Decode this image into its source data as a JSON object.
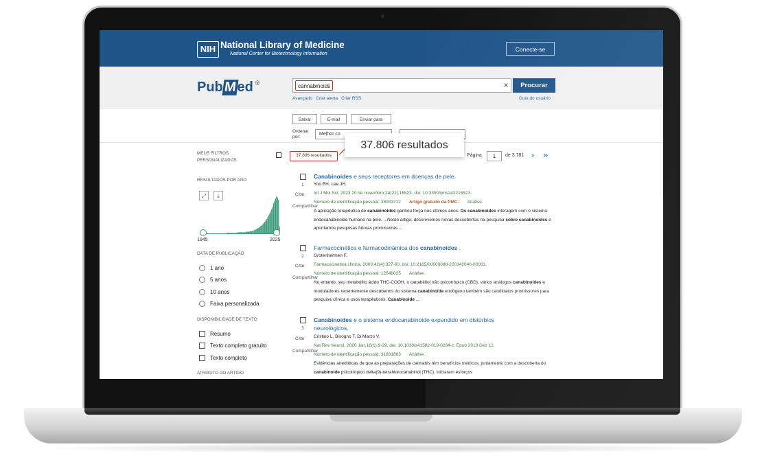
{
  "header": {
    "nih_badge": "NIH",
    "org_name": "National Library of Medicine",
    "org_sub": "National Center for Biotechnology Information",
    "login_label": "Conecte-se"
  },
  "search": {
    "logo_pub": "Pub",
    "logo_m": "M",
    "logo_ed": "ed",
    "logo_reg": "®",
    "query": "cannabinoids",
    "clear_icon": "×",
    "submit_label": "Procurar",
    "links": [
      "Avançado",
      "Criar alerta",
      "Criar RSS"
    ],
    "guide_link": "Guia do usuário"
  },
  "actions": {
    "save": "Salvar",
    "email": "E-mail",
    "send_to": "Enviar para",
    "sort_label": "Ordenar por:",
    "sort_value": "Melhor co"
  },
  "callout": {
    "text": "37.806 resultados"
  },
  "sidebar": {
    "my_filters": "MEUS FILTROS PERSONALIZADOS",
    "results_by_year": "RESULTADOS POR ANO",
    "expand_icon": "expand-icon",
    "download_icon": "download-icon",
    "year_start": "1945",
    "year_end": "2025",
    "pub_date_heading": "DATA DE PUBLICAÇÃO",
    "pub_date_options": [
      "1 ano",
      "5 anos",
      "10 anos",
      "Faixa personalizada"
    ],
    "text_avail_heading": "DISPONIBILIDADE DE TEXTO",
    "text_avail_options": [
      "Resumo",
      "Texto completo gratuito",
      "Texto completo"
    ],
    "article_attr_heading": "ATRIBUTO DO ARTIGO"
  },
  "chart_data": {
    "type": "area",
    "title": "",
    "xlabel": "",
    "ylabel": "",
    "x_range": [
      1945,
      2025
    ],
    "values": [
      0,
      0,
      0,
      0,
      0,
      0,
      0,
      0,
      0,
      0,
      0,
      0,
      0,
      0,
      0,
      0,
      0,
      0,
      0,
      0,
      0,
      0,
      0,
      0,
      0,
      0,
      0,
      1,
      1,
      1,
      1,
      1,
      1,
      1,
      1,
      1,
      1,
      1,
      2,
      2,
      2,
      2,
      2,
      2,
      2,
      2,
      3,
      3,
      3,
      3,
      4,
      4,
      4,
      5,
      5,
      6,
      7,
      8,
      9,
      10,
      11,
      13,
      14,
      16,
      18,
      20,
      22,
      25,
      28,
      31,
      34,
      38,
      42,
      46,
      52,
      56,
      60,
      64,
      62,
      58,
      12
    ],
    "color": "#3c9a7a"
  },
  "results": {
    "count_label": "37.806 resultados",
    "page_label": "Página",
    "page_value": "1",
    "page_total": "de 3.781",
    "next_icon": "chevron-right-icon",
    "last_icon": "double-chevron-right-icon",
    "cite_label": "Citar",
    "share_label": "Compartilhar",
    "items": [
      {
        "number": "1",
        "title_bold": "Canabinoides",
        "title_rest": " e seus receptores em doenças de pele.",
        "authors": "Yoo EH, Lee JH.",
        "journal": "Int J Mol Sci. 2023 20 de novembro;24(22):16523. doi: 10.3390/ijms242216523.",
        "pmid": "Número de identificação pessoal: 38003712",
        "free": "Artigo gratuito da PMC.",
        "analysis": "Análise.",
        "snippet_html": "A aplicação terapêutica de <b>canabinoides</b> ganhou força nos últimos anos. <b>Os canabinoides</b> interagem com o sistema endocanabinoide humano na pele. ...Neste artigo, descrevemos novas descobertas na pesquisa <b>sobre canabinoides</b> e apontamos pesquisas futuras promissoras ..."
      },
      {
        "number": "2",
        "title_pre": "Farmacocinética e farmacodinâmica dos ",
        "title_bold": "canabinoides",
        "title_post": " .",
        "authors": "Grotenhermen F.",
        "journal": "Farmacocinética clínica. 2003;42(4):327-60. doi: 10.2165/00003088-200342040-00003.",
        "pmid": "Número de identificação pessoal: 12648025",
        "analysis": "Análise.",
        "snippet_html": "No entanto, seu metabólito ácido THC-COOH, o canabidiol não psicotrópico (CBD), vários análogos <b>canabinoides</b> e moduladores recentemente descobertos do sistema <b>canabinoide</b> endógeno também são candidatos promissores para pesquisa clínica e usos terapêuticos. <b>Canabinoide</b> ..."
      },
      {
        "number": "3",
        "title_bold": "Canabinoides",
        "title_rest": " e o sistema endocanabinoide expandido em distúrbios neurológicos.",
        "authors": "Cristino L, Bisogno T, Di Marzo V.",
        "journal": "Nat Rev Neurol. 2020 Jan;16(1):9-29. doi: 10.1038/s41582-019-0284-z. Epub 2019 Dez 12.",
        "pmid": "Número de identificação pessoal: 31831863",
        "analysis": "Análise.",
        "snippet_html": "Evidências anedóticas de que as preparações de cannabis têm benefícios médicos, juntamente com a descoberta do <b>canabinoide</b> psicotrópico delta(9)-tetrahidrocanabinol (THC), iniciaram esforços"
      }
    ]
  }
}
